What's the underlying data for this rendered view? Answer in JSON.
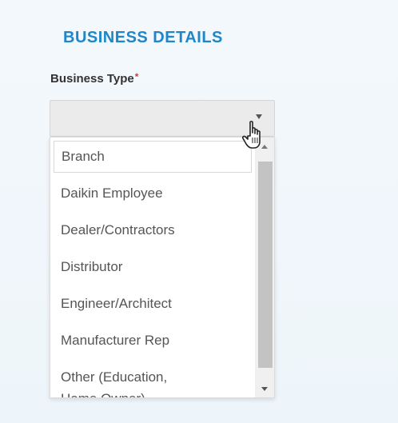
{
  "business_details": {
    "section_title": "BUSINESS DETAILS",
    "business_type": {
      "label": "Business Type",
      "required_marker": "*",
      "selected_value": "",
      "options": [
        "Branch",
        "Daikin Employee",
        "Dealer/Contractors",
        "Distributor",
        "Engineer/Architect",
        "Manufacturer Rep",
        "Other (Education,",
        "Home Owner)"
      ],
      "highlighted_option": "Branch"
    }
  },
  "icons": {
    "dropdown_arrow": "chevron-down-icon",
    "cursor": "hand-pointer-icon",
    "scroll_down": "scroll-down-arrow-icon",
    "scroll_up": "scroll-up-arrow-icon"
  },
  "colors": {
    "title": "#1f86c9",
    "required": "#d33a3a",
    "select_bg": "#ebebeb",
    "option_text": "#555555",
    "scroll_thumb": "#c3c3c3"
  }
}
